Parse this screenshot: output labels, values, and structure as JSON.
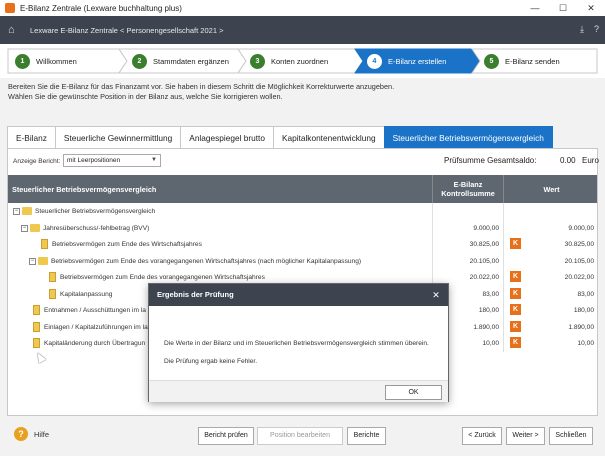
{
  "window": {
    "title": "E-Bilanz Zentrale (Lexware buchhaltung plus)",
    "controls": [
      "—",
      "☐",
      "✕"
    ]
  },
  "header": {
    "breadcrumb": "Lexware E-Bilanz Zentrale < Personengesellschaft 2021 >"
  },
  "steps": [
    {
      "num": "1",
      "label": "Willkommen"
    },
    {
      "num": "2",
      "label": "Stammdaten ergänzen"
    },
    {
      "num": "3",
      "label": "Konten zuordnen"
    },
    {
      "num": "4",
      "label": "E-Bilanz erstellen"
    },
    {
      "num": "5",
      "label": "E-Bilanz senden"
    }
  ],
  "instructions": {
    "line1": "Bereiten Sie die E-Bilanz für das Finanzamt vor. Sie haben in diesem Schritt die Möglichkeit Korrekturwerte anzugeben.",
    "line2": "Wählen Sie die gewünschte Position in der Bilanz aus, welche Sie korrigieren wollen."
  },
  "tabs": [
    {
      "label": "E-Bilanz"
    },
    {
      "label": "Steuerliche Gewinnermittlung"
    },
    {
      "label": "Anlagespiegel brutto"
    },
    {
      "label": "Kapitalkontenentwicklung"
    },
    {
      "label": "Steuerlicher Betriebsvermögensvergleich"
    }
  ],
  "toolbar": {
    "anzeige_label": "Anzeige Bericht:",
    "anzeige_value": "mit Leerpositionen",
    "pruefsumme_label": "Prüfsumme Gesamtsaldo:",
    "pruefsumme_value": "0.00",
    "pruefsumme_currency": "Euro"
  },
  "table": {
    "col1": "Steuerlicher Betriebsvermögensvergleich",
    "col2_line1": "E-Bilanz",
    "col2_line2": "Kontrollsumme",
    "col3": "Wert",
    "rows": [
      {
        "label": "Steuerlicher Betriebsvermögensvergleich",
        "kontroll": "",
        "wert": "",
        "k": ""
      },
      {
        "label": "Jahresüberschuss/-fehlbetrag (BVV)",
        "kontroll": "9.000,00",
        "wert": "9.000,00",
        "k": ""
      },
      {
        "label": "Betriebsvermögen zum Ende des Wirtschaftsjahres",
        "kontroll": "30.825,00",
        "wert": "30.825,00",
        "k": "K"
      },
      {
        "label": "Betriebsvermögen zum Ende des vorangegangenen Wirtschaftsjahres (nach möglicher Kapitalanpassung)",
        "kontroll": "20.105,00",
        "wert": "20.105,00",
        "k": ""
      },
      {
        "label": "Betriebsvermögen zum Ende des vorangegangenen Wirtschaftsjahres",
        "kontroll": "20.022,00",
        "wert": "20.022,00",
        "k": "K"
      },
      {
        "label": "Kapitalanpassung",
        "kontroll": "83,00",
        "wert": "83,00",
        "k": "K"
      },
      {
        "label": "Entnahmen / Ausschüttungen im la",
        "kontroll": "180,00",
        "wert": "180,00",
        "k": "K"
      },
      {
        "label": "Einlagen / Kapitalzuführungen im la",
        "kontroll": "1.890,00",
        "wert": "1.890,00",
        "k": "K"
      },
      {
        "label": "Kapitaländerung durch Übertragun",
        "kontroll": "10,00",
        "wert": "10,00",
        "k": "K"
      }
    ]
  },
  "bottom": {
    "help": "Hilfe",
    "bericht_pruefen": "Bericht prüfen",
    "position_bearbeiten": "Position bearbeiten",
    "berichte": "Berichte",
    "zurueck": "< Zurück",
    "weiter": "Weiter >",
    "schliessen": "Schließen"
  },
  "dialog": {
    "title": "Ergebnis der Prüfung",
    "message1": "Die Werte in der Bilanz und im Steuerlichen Betriebsvermögensvergleich stimmen überein.",
    "message2": "Die Prüfung ergab keine Fehler.",
    "ok": "OK"
  }
}
